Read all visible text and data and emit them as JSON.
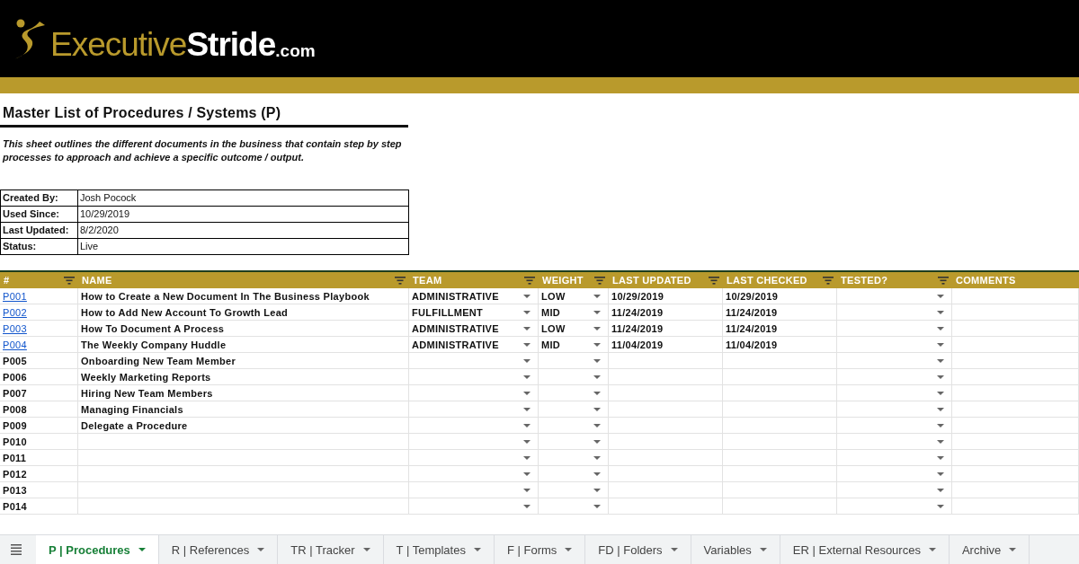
{
  "logo": {
    "first": "Executive",
    "second": "Stride",
    "suffix": ".com"
  },
  "title": "Master List of Procedures / Systems (P)",
  "description": "This sheet outlines the different documents in the business that contain step by step processes to approach and achieve a specific outcome / output.",
  "info": [
    {
      "label": "Created By:",
      "value": "Josh Pocock"
    },
    {
      "label": "Used Since:",
      "value": "10/29/2019"
    },
    {
      "label": "Last Updated:",
      "value": "8/2/2020"
    },
    {
      "label": "Status:",
      "value": "Live"
    }
  ],
  "table": {
    "columns": [
      {
        "label": "#",
        "filter": true,
        "dropdown": false
      },
      {
        "label": "NAME",
        "filter": true,
        "dropdown": false
      },
      {
        "label": "TEAM",
        "filter": true,
        "dropdown": true
      },
      {
        "label": "WEIGHT",
        "filter": true,
        "dropdown": true
      },
      {
        "label": "LAST UPDATED",
        "filter": true,
        "dropdown": false
      },
      {
        "label": "LAST CHECKED",
        "filter": true,
        "dropdown": false
      },
      {
        "label": "TESTED?",
        "filter": true,
        "dropdown": true
      },
      {
        "label": "COMMENTS",
        "filter": false,
        "dropdown": false
      }
    ],
    "rows": [
      {
        "link": true,
        "cells": [
          "P001",
          "How to Create a New Document In The Business Playbook",
          "ADMINISTRATIVE",
          "LOW",
          "10/29/2019",
          "10/29/2019",
          "",
          ""
        ]
      },
      {
        "link": true,
        "cells": [
          "P002",
          "How to Add New Account To Growth Lead",
          "FULFILLMENT",
          "MID",
          "11/24/2019",
          "11/24/2019",
          "",
          ""
        ]
      },
      {
        "link": true,
        "cells": [
          "P003",
          "How To Document A Process",
          "ADMINISTRATIVE",
          "LOW",
          "11/24/2019",
          "11/24/2019",
          "",
          ""
        ]
      },
      {
        "link": true,
        "cells": [
          "P004",
          "The Weekly Company Huddle",
          "ADMINISTRATIVE",
          "MID",
          "11/04/2019",
          "11/04/2019",
          "",
          ""
        ]
      },
      {
        "link": false,
        "cells": [
          "P005",
          "Onboarding New Team Member",
          "",
          "",
          "",
          "",
          "",
          ""
        ]
      },
      {
        "link": false,
        "cells": [
          "P006",
          "Weekly Marketing Reports",
          "",
          "",
          "",
          "",
          "",
          ""
        ]
      },
      {
        "link": false,
        "cells": [
          "P007",
          "Hiring New Team Members",
          "",
          "",
          "",
          "",
          "",
          ""
        ]
      },
      {
        "link": false,
        "cells": [
          "P008",
          "Managing Financials",
          "",
          "",
          "",
          "",
          "",
          ""
        ]
      },
      {
        "link": false,
        "cells": [
          "P009",
          "Delegate a Procedure",
          "",
          "",
          "",
          "",
          "",
          ""
        ]
      },
      {
        "link": false,
        "cells": [
          "P010",
          "",
          "",
          "",
          "",
          "",
          "",
          ""
        ]
      },
      {
        "link": false,
        "cells": [
          "P011",
          "",
          "",
          "",
          "",
          "",
          "",
          ""
        ]
      },
      {
        "link": false,
        "cells": [
          "P012",
          "",
          "",
          "",
          "",
          "",
          "",
          ""
        ]
      },
      {
        "link": false,
        "cells": [
          "P013",
          "",
          "",
          "",
          "",
          "",
          "",
          ""
        ]
      },
      {
        "link": false,
        "cells": [
          "P014",
          "",
          "",
          "",
          "",
          "",
          "",
          ""
        ]
      }
    ]
  },
  "sheet_tabs": [
    {
      "label": "P | Procedures",
      "selected": true
    },
    {
      "label": "R | References",
      "selected": false
    },
    {
      "label": "TR | Tracker",
      "selected": false
    },
    {
      "label": "T | Templates",
      "selected": false
    },
    {
      "label": "F | Forms",
      "selected": false
    },
    {
      "label": "FD | Folders",
      "selected": false
    },
    {
      "label": "Variables",
      "selected": false
    },
    {
      "label": "ER | External Resources",
      "selected": false
    },
    {
      "label": "Archive",
      "selected": false
    }
  ]
}
